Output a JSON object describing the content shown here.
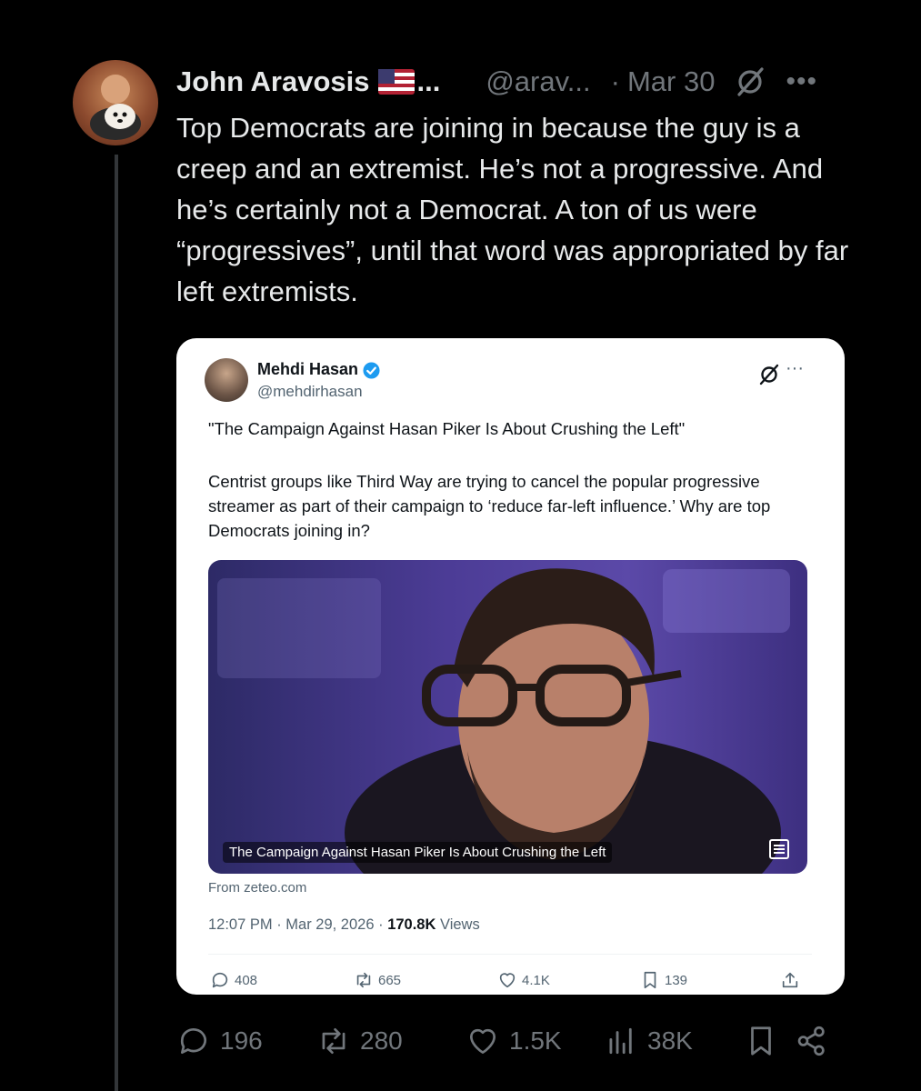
{
  "tweet": {
    "author_name": "John Aravosis",
    "author_handle": "@arav...",
    "separator": "·",
    "date": "Mar 30",
    "text": "Top Democrats are joining in because the guy is a creep and an extremist. He’s not a progressive. And he’s certainly not a Democrat. A ton of us were “progressives”, until that word was appropriated by far left extremists."
  },
  "quote": {
    "author_name": "Mehdi Hasan",
    "author_handle": "@mehdirhasan",
    "headline": "\"The Campaign Against Hasan Piker Is About Crushing the Left\"",
    "body": "Centrist groups like Third Way are trying to cancel the popular progressive streamer as part of their campaign to ‘reduce far-left influence.’ Why are top Democrats joining in?",
    "media_caption": "The Campaign Against Hasan Piker Is About Crushing the Left",
    "source": "From zeteo.com",
    "meta_time": "12:07 PM · Mar 29, 2026 · ",
    "meta_views": "170.8K",
    "meta_views_label": " Views",
    "stats": {
      "replies": "408",
      "reposts": "665",
      "likes": "4.1K",
      "bookmarks": "139"
    }
  },
  "actions": {
    "replies": "196",
    "reposts": "280",
    "likes": "1.5K",
    "views": "38K"
  },
  "colors": {
    "background": "#000000",
    "text": "#e7e9ea",
    "muted": "#71767b",
    "verified": "#1d9bf0"
  },
  "icons": [
    "grok-icon",
    "more-icon",
    "verified-badge-icon",
    "reply-icon",
    "repost-icon",
    "like-icon",
    "views-icon",
    "bookmark-icon",
    "share-icon",
    "upload-icon"
  ]
}
